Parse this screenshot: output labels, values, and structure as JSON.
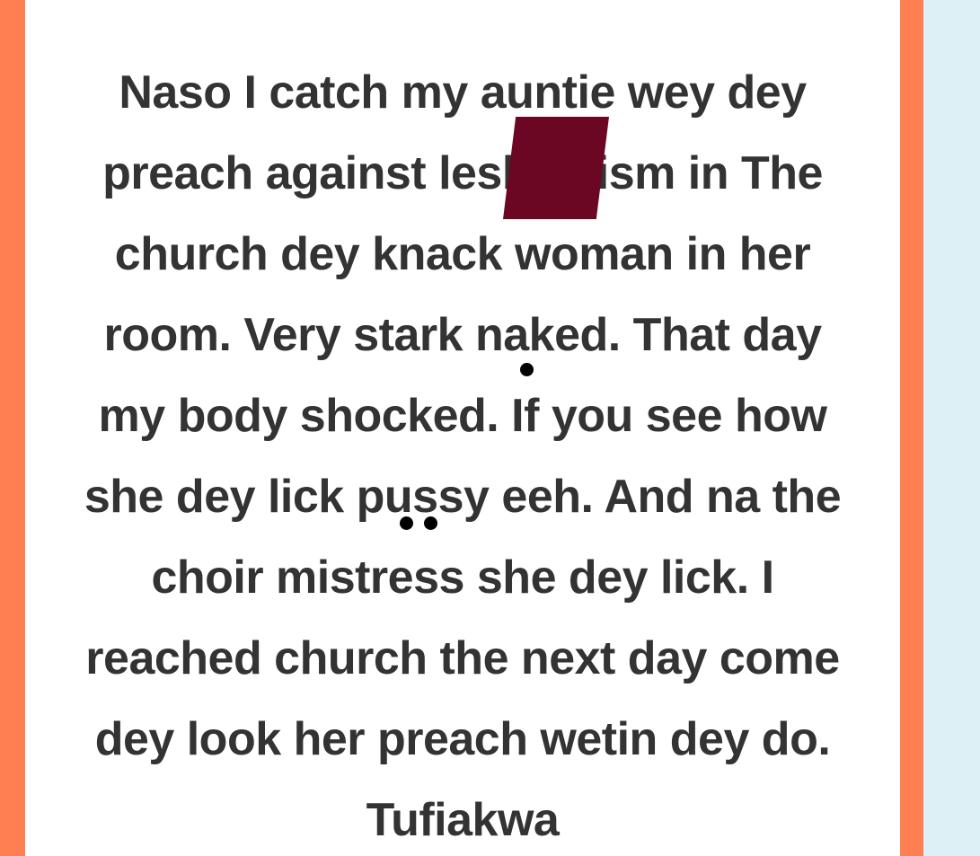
{
  "post": {
    "lines": [
      "Naso I catch my auntie wey dey",
      "preach against lesbianism in The",
      "church dey knack woman in her",
      "room. Very stark naked. That day",
      "my body shocked. If you see how",
      "she dey lick pussy eeh. And na the",
      "choir mistress she dey lick. I",
      "reached church the next day come",
      "dey look her preach wetin dey do.",
      "Tufiakwa"
    ]
  },
  "colors": {
    "frame": "#fd7f52",
    "card": "#ffffff",
    "background": "#dcf0f5",
    "text": "#333333",
    "censor": "#6b0723"
  }
}
